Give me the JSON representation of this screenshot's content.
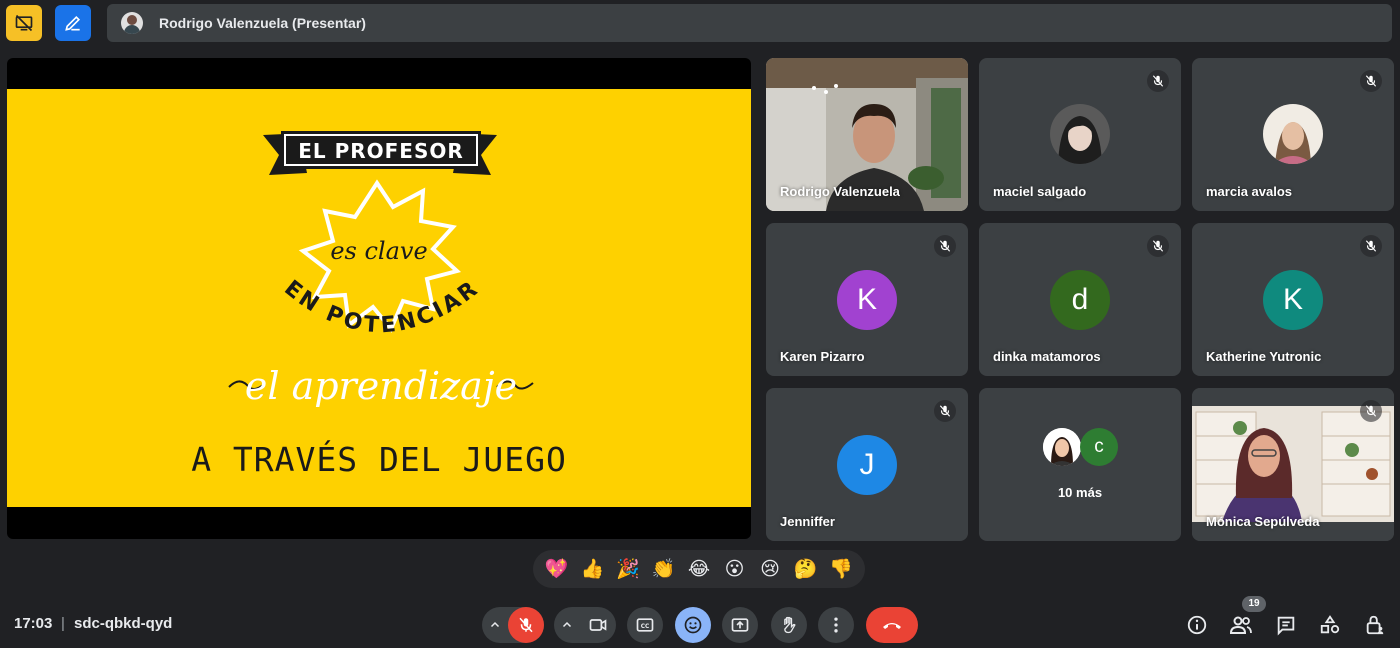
{
  "presenter": {
    "name": "Rodrigo Valenzuela (Presentar)"
  },
  "slide": {
    "ribbon": "EL PROFESOR",
    "burst": "es clave",
    "arc": "EN POTENCIAR",
    "script": "el aprendizaje",
    "bottom": "A TRAVÉS DEL JUEGO"
  },
  "participants": [
    {
      "name": "Rodrigo Valenzuela",
      "type": "video"
    },
    {
      "name": "maciel salgado",
      "type": "photo",
      "muted": true
    },
    {
      "name": "marcia avalos",
      "type": "photo",
      "muted": true
    },
    {
      "name": "Karen Pizarro",
      "initial": "K",
      "color": "#a142d0",
      "muted": true
    },
    {
      "name": "dinka matamoros",
      "initial": "d",
      "color": "#33691e",
      "muted": true
    },
    {
      "name": "Katherine Yutronic",
      "initial": "K",
      "color": "#0f8a7e",
      "muted": true
    },
    {
      "name": "Jenniffer",
      "initial": "J",
      "color": "#1e88e5",
      "muted": true
    },
    {
      "name": "Mónica Sepúlveda",
      "type": "video",
      "muted": true
    }
  ],
  "more_tile": {
    "label": "10 más",
    "initial": "c",
    "color": "#2e7d32"
  },
  "reactions": [
    "💖",
    "👍",
    "🎉",
    "👏",
    "😂",
    "😮",
    "😢",
    "🤔",
    "👎"
  ],
  "bottom": {
    "time": "17:03",
    "separator": "|",
    "meeting_code": "sdc-qbkd-qyd",
    "participant_count": "19"
  },
  "colors": {
    "slide_bg": "#fed100",
    "end_call": "#ea4335",
    "mic_muted": "#ea4335",
    "emoji_active": "#8ab4f8"
  }
}
